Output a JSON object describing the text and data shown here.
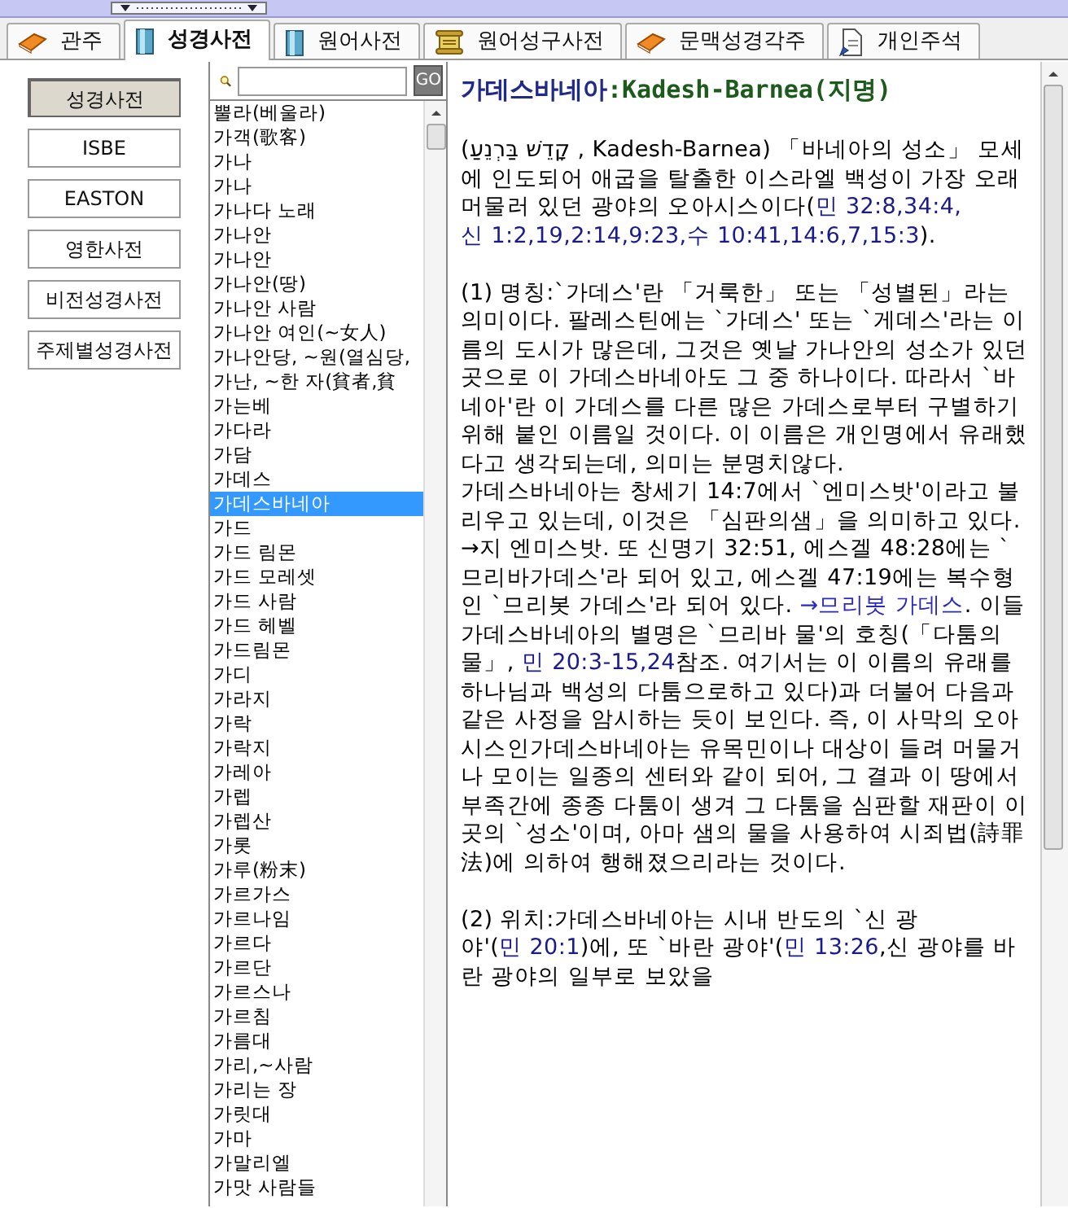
{
  "tabs": [
    {
      "label": "관주",
      "selected": false
    },
    {
      "label": "성경사전",
      "selected": true
    },
    {
      "label": "원어사전",
      "selected": false
    },
    {
      "label": "원어성구사전",
      "selected": false
    },
    {
      "label": "문맥성경각주",
      "selected": false
    },
    {
      "label": "개인주석",
      "selected": false
    }
  ],
  "dictionaries": [
    {
      "label": "성경사전",
      "selected": true
    },
    {
      "label": "ISBE",
      "selected": false
    },
    {
      "label": "EASTON",
      "selected": false
    },
    {
      "label": "영한사전",
      "selected": false
    },
    {
      "label": "비전성경사전",
      "selected": false
    },
    {
      "label": "주제별성경사전",
      "selected": false
    }
  ],
  "search": {
    "button": "GO"
  },
  "entries": [
    {
      "label": "뿔라(베울라)",
      "selected": false
    },
    {
      "label": "가객(歌客)",
      "selected": false
    },
    {
      "label": "가나",
      "selected": false
    },
    {
      "label": "가나",
      "selected": false
    },
    {
      "label": "가나다 노래",
      "selected": false
    },
    {
      "label": "가나안",
      "selected": false
    },
    {
      "label": "가나안",
      "selected": false
    },
    {
      "label": "가나안(땅)",
      "selected": false
    },
    {
      "label": "가나안 사람",
      "selected": false
    },
    {
      "label": "가나안 여인(~女人)",
      "selected": false
    },
    {
      "label": "가나안당, ~원(열심당,",
      "selected": false
    },
    {
      "label": "가난, ~한 자(貧者,貧",
      "selected": false
    },
    {
      "label": "가는베",
      "selected": false
    },
    {
      "label": "가다라",
      "selected": false
    },
    {
      "label": "가담",
      "selected": false
    },
    {
      "label": "가데스",
      "selected": false
    },
    {
      "label": "가데스바네아",
      "selected": true
    },
    {
      "label": "가드",
      "selected": false
    },
    {
      "label": "가드 림몬",
      "selected": false
    },
    {
      "label": "가드 모레셋",
      "selected": false
    },
    {
      "label": "가드 사람",
      "selected": false
    },
    {
      "label": "가드 헤벨",
      "selected": false
    },
    {
      "label": "가드림몬",
      "selected": false
    },
    {
      "label": "가디",
      "selected": false
    },
    {
      "label": "가라지",
      "selected": false
    },
    {
      "label": "가락",
      "selected": false
    },
    {
      "label": "가락지",
      "selected": false
    },
    {
      "label": "가레아",
      "selected": false
    },
    {
      "label": "가렙",
      "selected": false
    },
    {
      "label": "가렙산",
      "selected": false
    },
    {
      "label": "가롯",
      "selected": false
    },
    {
      "label": "가루(粉末)",
      "selected": false
    },
    {
      "label": "가르가스",
      "selected": false
    },
    {
      "label": "가르나임",
      "selected": false
    },
    {
      "label": "가르다",
      "selected": false
    },
    {
      "label": "가르단",
      "selected": false
    },
    {
      "label": "가르스나",
      "selected": false
    },
    {
      "label": "가르침",
      "selected": false
    },
    {
      "label": "가름대",
      "selected": false
    },
    {
      "label": "가리,~사람",
      "selected": false
    },
    {
      "label": "가리는 장",
      "selected": false
    },
    {
      "label": "가릿대",
      "selected": false
    },
    {
      "label": "가마",
      "selected": false
    },
    {
      "label": "가말리엘",
      "selected": false
    },
    {
      "label": "가맛 사람들",
      "selected": false
    }
  ],
  "article": {
    "title": "가데스바네아",
    "title_en": ":Kadesh-Barnea(지명)",
    "paragraphs": [
      {
        "kind": "section",
        "segments": [
          {
            "kind": "plain",
            "text": "(קָדֵשׁ בַּרְנֵעַ , Kadesh-Barnea) 「바네아의 성소」 모세에 인도되어 애굽을 탈출한 이스라엘 백성이 가장 오래 머물러 있던 광야의 오아시스이다("
          },
          {
            "kind": "ref",
            "text": "민 32:8,34:4,"
          },
          {
            "kind": "ref",
            "text": "신 1:2,19,2:14,9:23,"
          },
          {
            "kind": "ref",
            "text": "수 10:41,14:6,7,15:3"
          },
          {
            "kind": "plain",
            "text": ")."
          }
        ]
      },
      {
        "kind": "section",
        "segments": [
          {
            "kind": "plain",
            "text": "(1) 명칭:`가데스'란 「거룩한」 또는 「성별된」라는 의미이다. 팔레스틴에는 `가데스' 또는 `게데스'라는 이름의 도시가 많은데, 그것은 옛날 가나안의 성소가 있던 곳으로 이 가데스바네아도 그 중 하나이다. 따라서 `바네아'란 이 가데스를 다른 많은 가데스로부터 구별하기 위해 붙인 이름일 것이다. 이 이름은 개인명에서 유래했다고 생각되는데, 의미는 분명치않다."
          }
        ]
      },
      {
        "kind": "continuation",
        "segments": [
          {
            "kind": "plain",
            "text": "가데스바네아는 창세기 14:7에서 `엔미스밧'이라고 불리우고 있는데, 이것은 「심판의샘」을 의미하고 있다. →지 엔미스밧. 또 신명기 32:51, 에스겔 48:28에는 `므리바가데스'라 되어 있고, 에스겔 47:19에는 복수형인 `므리봇 가데스'라 되어 있다. "
          },
          {
            "kind": "link",
            "text": "→므리봇 가데스"
          },
          {
            "kind": "plain",
            "text": ". 이들 가데스바네아의 별명은 `므리바 물'의 호칭(「다툼의물」, "
          },
          {
            "kind": "ref",
            "text": "민 20:3-15,24"
          },
          {
            "kind": "plain",
            "text": "참조. 여기서는 이 이름의 유래를 하나님과 백성의 다툼으로하고 있다)과 더불어 다음과 같은 사정을 암시하는 듯이 보인다. 즉, 이 사막의 오아시스인가데스바네아는 유목민이나 대상이 들려 머물거나 모이는 일종의 센터와 같이 되어, 그 결과 이 땅에서 부족간에 종종 다툼이 생겨 그 다툼을 심판할 재판이 이 곳의 `성소'이며, 아마 샘의 물을 사용하여 시죄법(詩罪法)에 의하여 행해졌으리라는 것이다."
          }
        ]
      },
      {
        "kind": "section",
        "segments": [
          {
            "kind": "plain",
            "text": "(2) 위치:가데스바네아는 시내 반도의 `신 광야'("
          },
          {
            "kind": "ref",
            "text": "민 20:1"
          },
          {
            "kind": "plain",
            "text": ")에, 또 `바란 광야'("
          },
          {
            "kind": "ref",
            "text": "민 13:26"
          },
          {
            "kind": "plain",
            "text": ",신 광야를 바란 광야의 일부로 보았을"
          }
        ]
      }
    ]
  }
}
